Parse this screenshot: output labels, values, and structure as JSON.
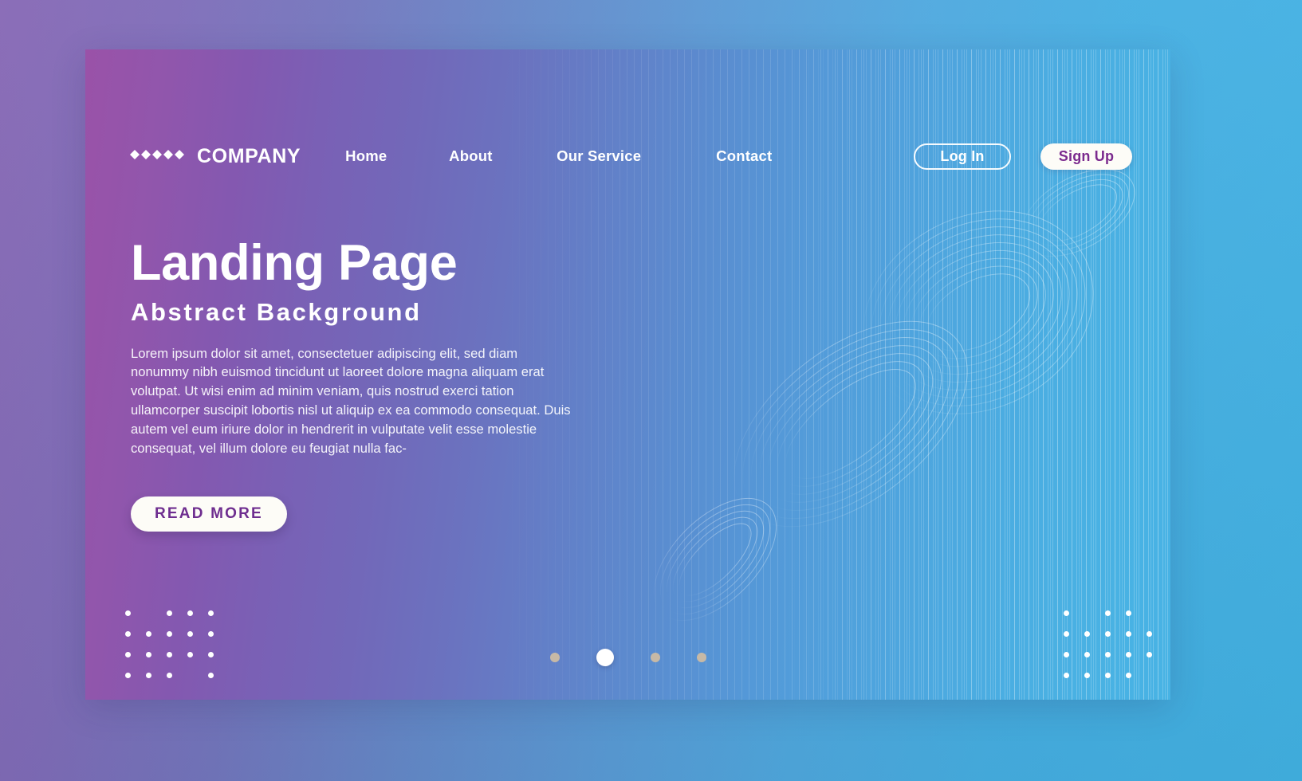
{
  "brand": {
    "name": "COMPANY",
    "logo_icon": "chevron-diamond-logo"
  },
  "nav": {
    "links": [
      {
        "label": "Home"
      },
      {
        "label": "About"
      },
      {
        "label": "Our Service"
      },
      {
        "label": "Contact"
      }
    ],
    "login_label": "Log In",
    "signup_label": "Sign Up"
  },
  "hero": {
    "title": "Landing Page",
    "subtitle": "Abstract Background",
    "paragraph": "Lorem ipsum dolor sit amet, consectetuer adipiscing elit, sed diam nonummy nibh euismod tincidunt ut laoreet dolore magna aliquam erat volutpat. Ut wisi enim ad minim veniam, quis nostrud exerci tation ullamcorper suscipit lobortis nisl ut aliquip ex ea commodo consequat. Duis autem vel eum iriure dolor in hendrerit in vulputate velit esse molestie consequat, vel illum dolore eu feugiat nulla fac-",
    "cta_label": "READ MORE"
  },
  "carousel": {
    "count": 4,
    "active_index": 1
  },
  "colors": {
    "gradient_start": "#9a52a8",
    "gradient_mid": "#6b72bf",
    "gradient_end": "#48b3e4",
    "button_text": "#6e2d8f",
    "button_fill": "#fdfcf7",
    "dot_inactive": "#c7b9a6",
    "dot_active": "#ffffff"
  }
}
